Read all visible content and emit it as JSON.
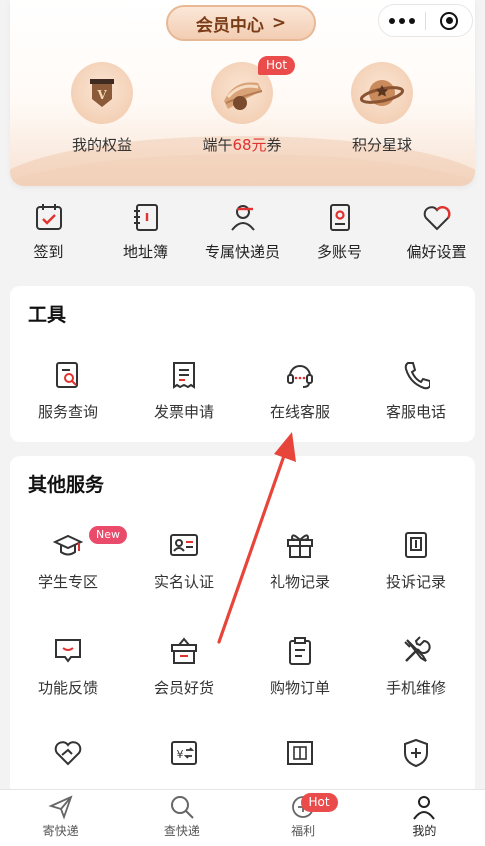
{
  "header": {
    "member_center": "会员中心",
    "member_center_chevron": ">"
  },
  "benefits": [
    {
      "label": "我的权益",
      "icon": "badge-v-icon"
    },
    {
      "label_prefix": "端午",
      "label_highlight": "68元",
      "label_suffix": "券",
      "badge": "Hot",
      "icon": "coupon-icon"
    },
    {
      "label": "积分星球",
      "icon": "planet-icon"
    }
  ],
  "quick": [
    {
      "label": "签到",
      "icon": "calendar-check-icon"
    },
    {
      "label": "地址簿",
      "icon": "address-book-icon"
    },
    {
      "label": "专属快递员",
      "icon": "courier-icon"
    },
    {
      "label": "多账号",
      "icon": "multi-account-icon"
    },
    {
      "label": "偏好设置",
      "icon": "heart-icon"
    }
  ],
  "tools": {
    "title": "工具",
    "items": [
      {
        "label": "服务查询",
        "icon": "doc-search-icon"
      },
      {
        "label": "发票申请",
        "icon": "receipt-icon"
      },
      {
        "label": "在线客服",
        "icon": "headset-icon"
      },
      {
        "label": "客服电话",
        "icon": "phone-icon"
      }
    ]
  },
  "other": {
    "title": "其他服务",
    "items": [
      {
        "label": "学生专区",
        "icon": "graduation-cap-icon",
        "badge": "New"
      },
      {
        "label": "实名认证",
        "icon": "id-card-icon"
      },
      {
        "label": "礼物记录",
        "icon": "gift-icon"
      },
      {
        "label": "投诉记录",
        "icon": "complaint-book-icon"
      },
      {
        "label": "功能反馈",
        "icon": "feedback-icon"
      },
      {
        "label": "会员好货",
        "icon": "shopping-box-icon"
      },
      {
        "label": "购物订单",
        "icon": "clipboard-icon"
      },
      {
        "label": "手机维修",
        "icon": "tools-icon"
      }
    ]
  },
  "tabbar": [
    {
      "label": "寄快递",
      "icon": "send-icon"
    },
    {
      "label": "查快递",
      "icon": "search-icon"
    },
    {
      "label": "福利",
      "icon": "gift-coin-icon",
      "badge": "Hot"
    },
    {
      "label": "我的",
      "icon": "user-icon"
    }
  ],
  "colors": {
    "accent": "#e0322f",
    "brand_gold": "#7a3c17",
    "arrow": "#e8453a"
  }
}
